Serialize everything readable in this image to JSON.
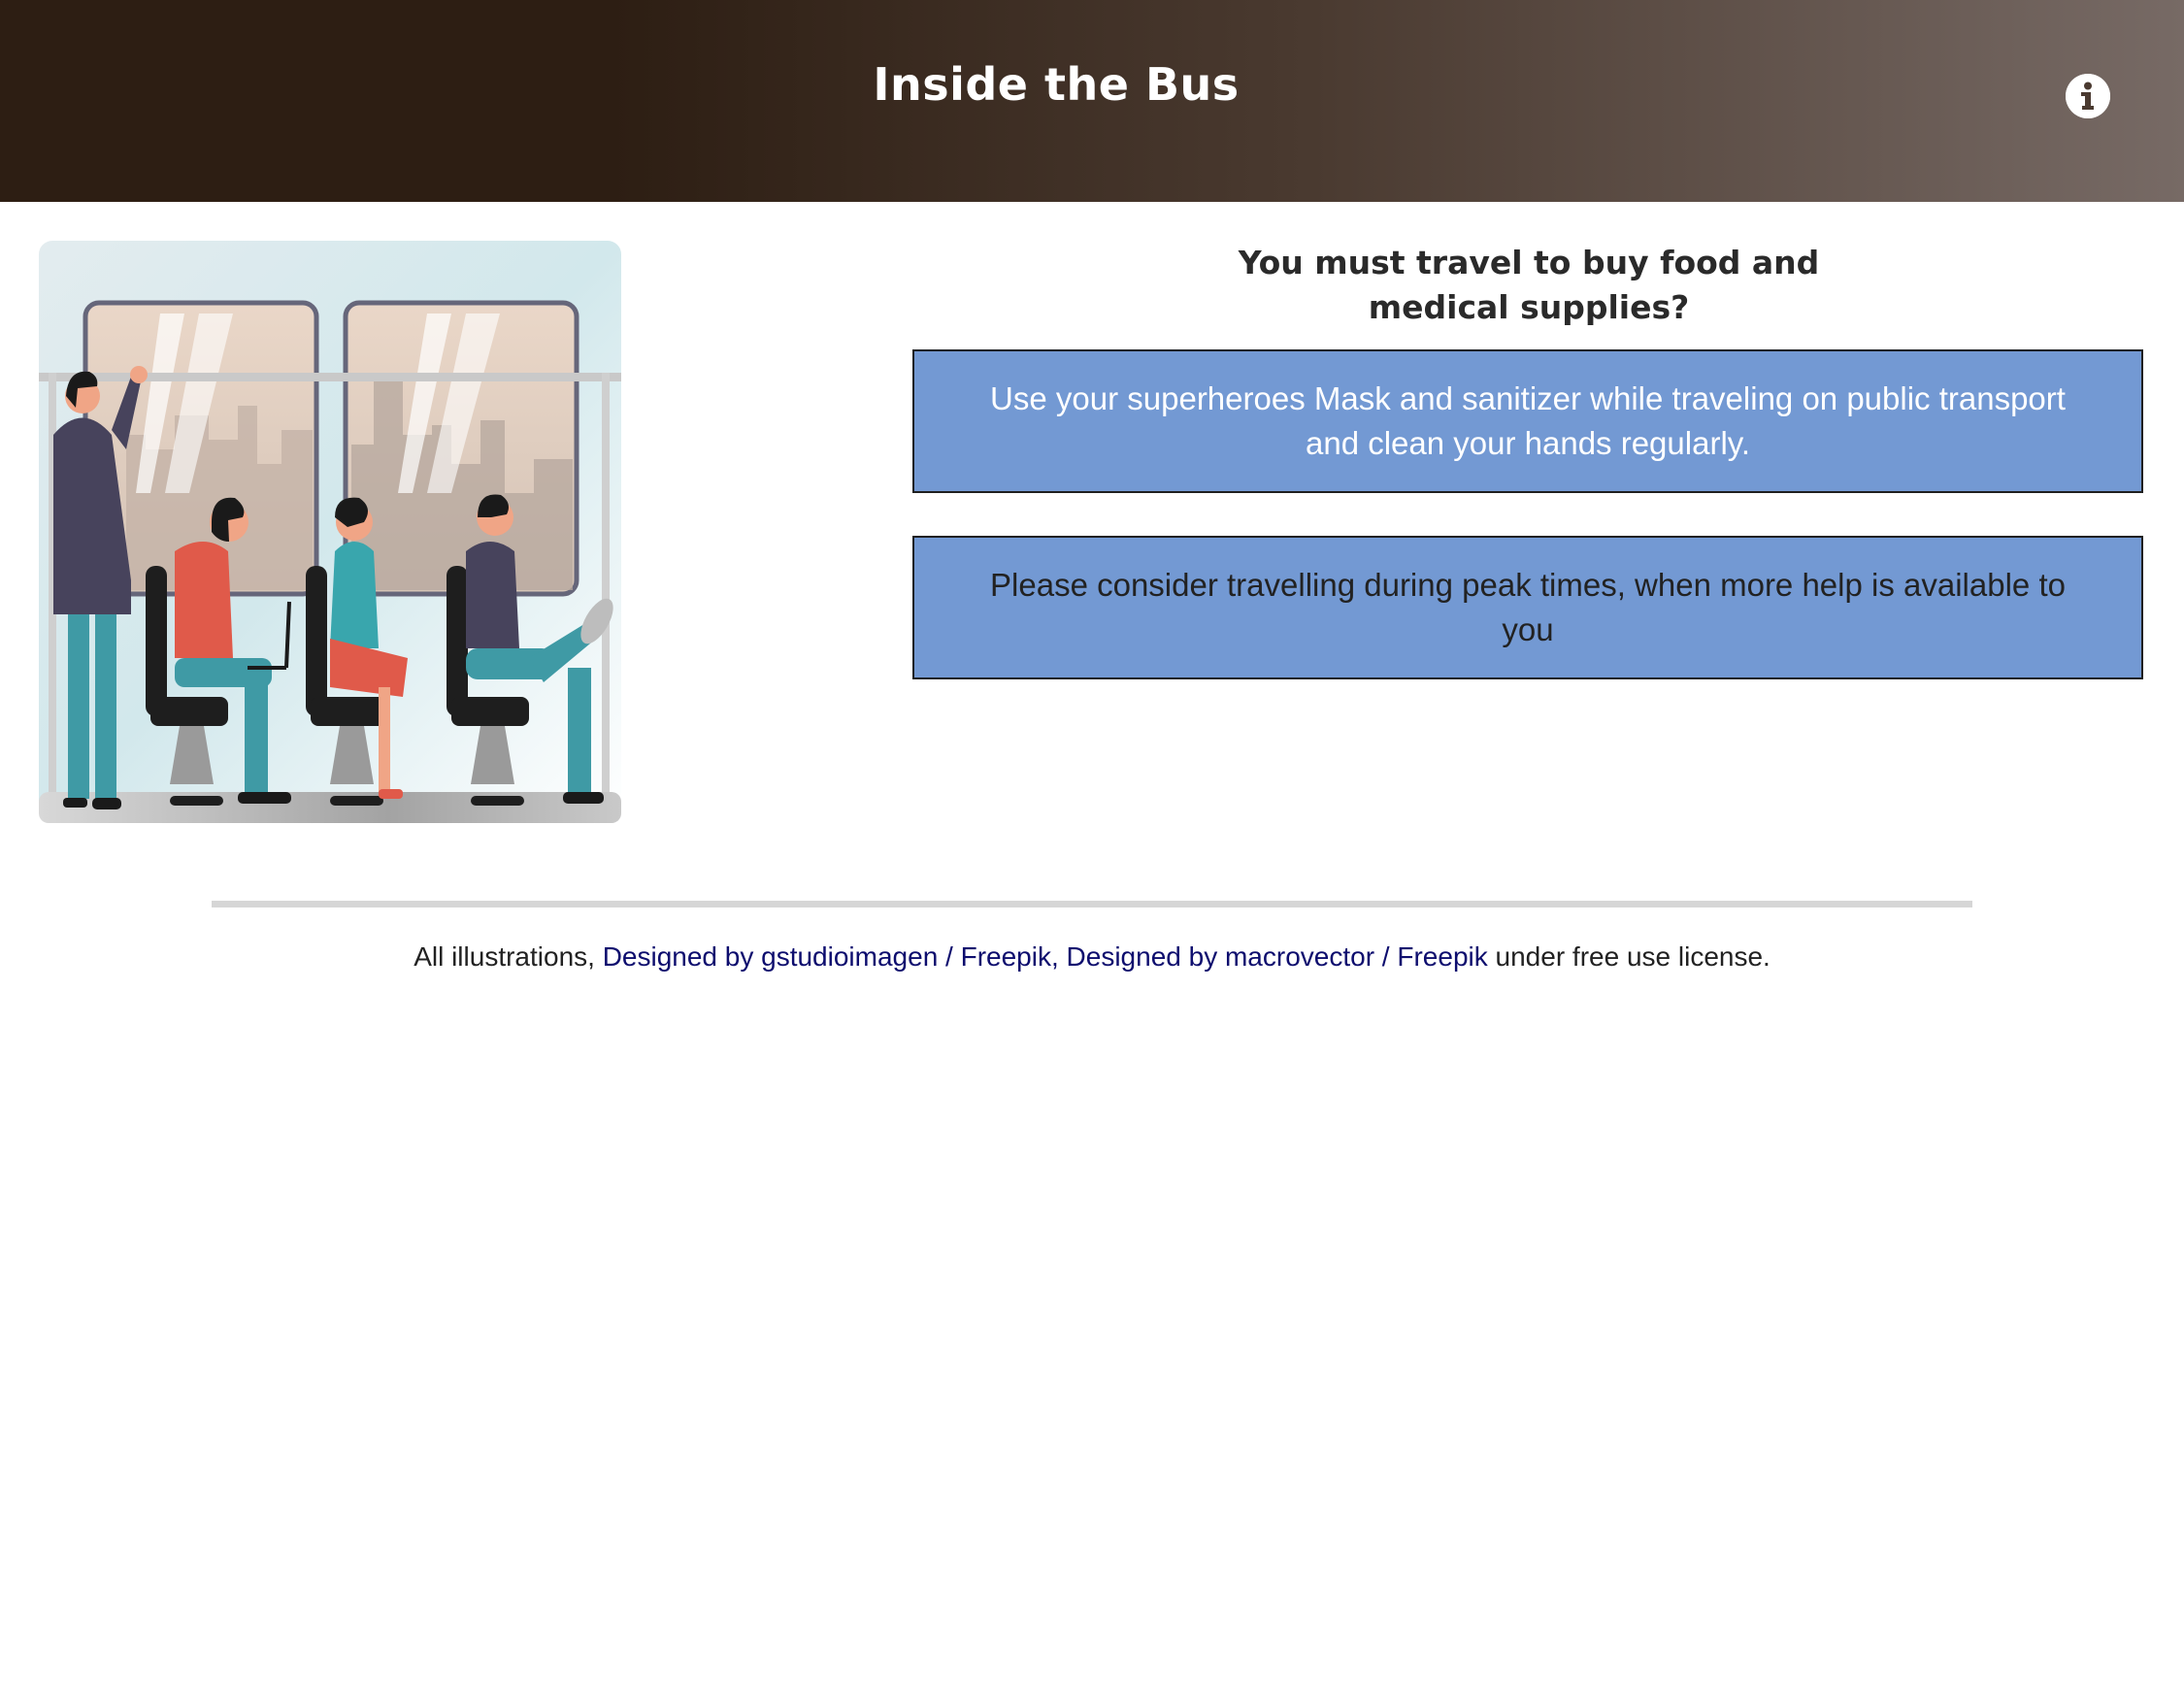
{
  "header": {
    "title": "Inside the Bus",
    "info_icon": "info-circle-icon",
    "background_start": "#2d1e13",
    "background_end": "#776a65"
  },
  "illustration": {
    "subject": "people-on-bus-illustration"
  },
  "main": {
    "question_line1": "You must travel to buy food and",
    "question_line2": "medical supplies?",
    "tips": [
      {
        "text": "Use your superheroes Mask and sanitizer while traveling on public transport and clean your hands regularly."
      },
      {
        "text": "Please consider travelling during peak times, when more help is available to you"
      }
    ],
    "tip_background": "#7399d3"
  },
  "footer": {
    "prefix": "All illustrations, ",
    "link1_part1": "Designed by gstudioimagen",
    "link1_sep": " / ",
    "link1_part2": "Freepik",
    "comma": ", ",
    "link2_part1": "Designed by macrovector",
    "link2_sep": " / ",
    "link2_part2": "Freepik",
    "suffix": " under free use license.",
    "link_color": "#0d0d6e"
  }
}
